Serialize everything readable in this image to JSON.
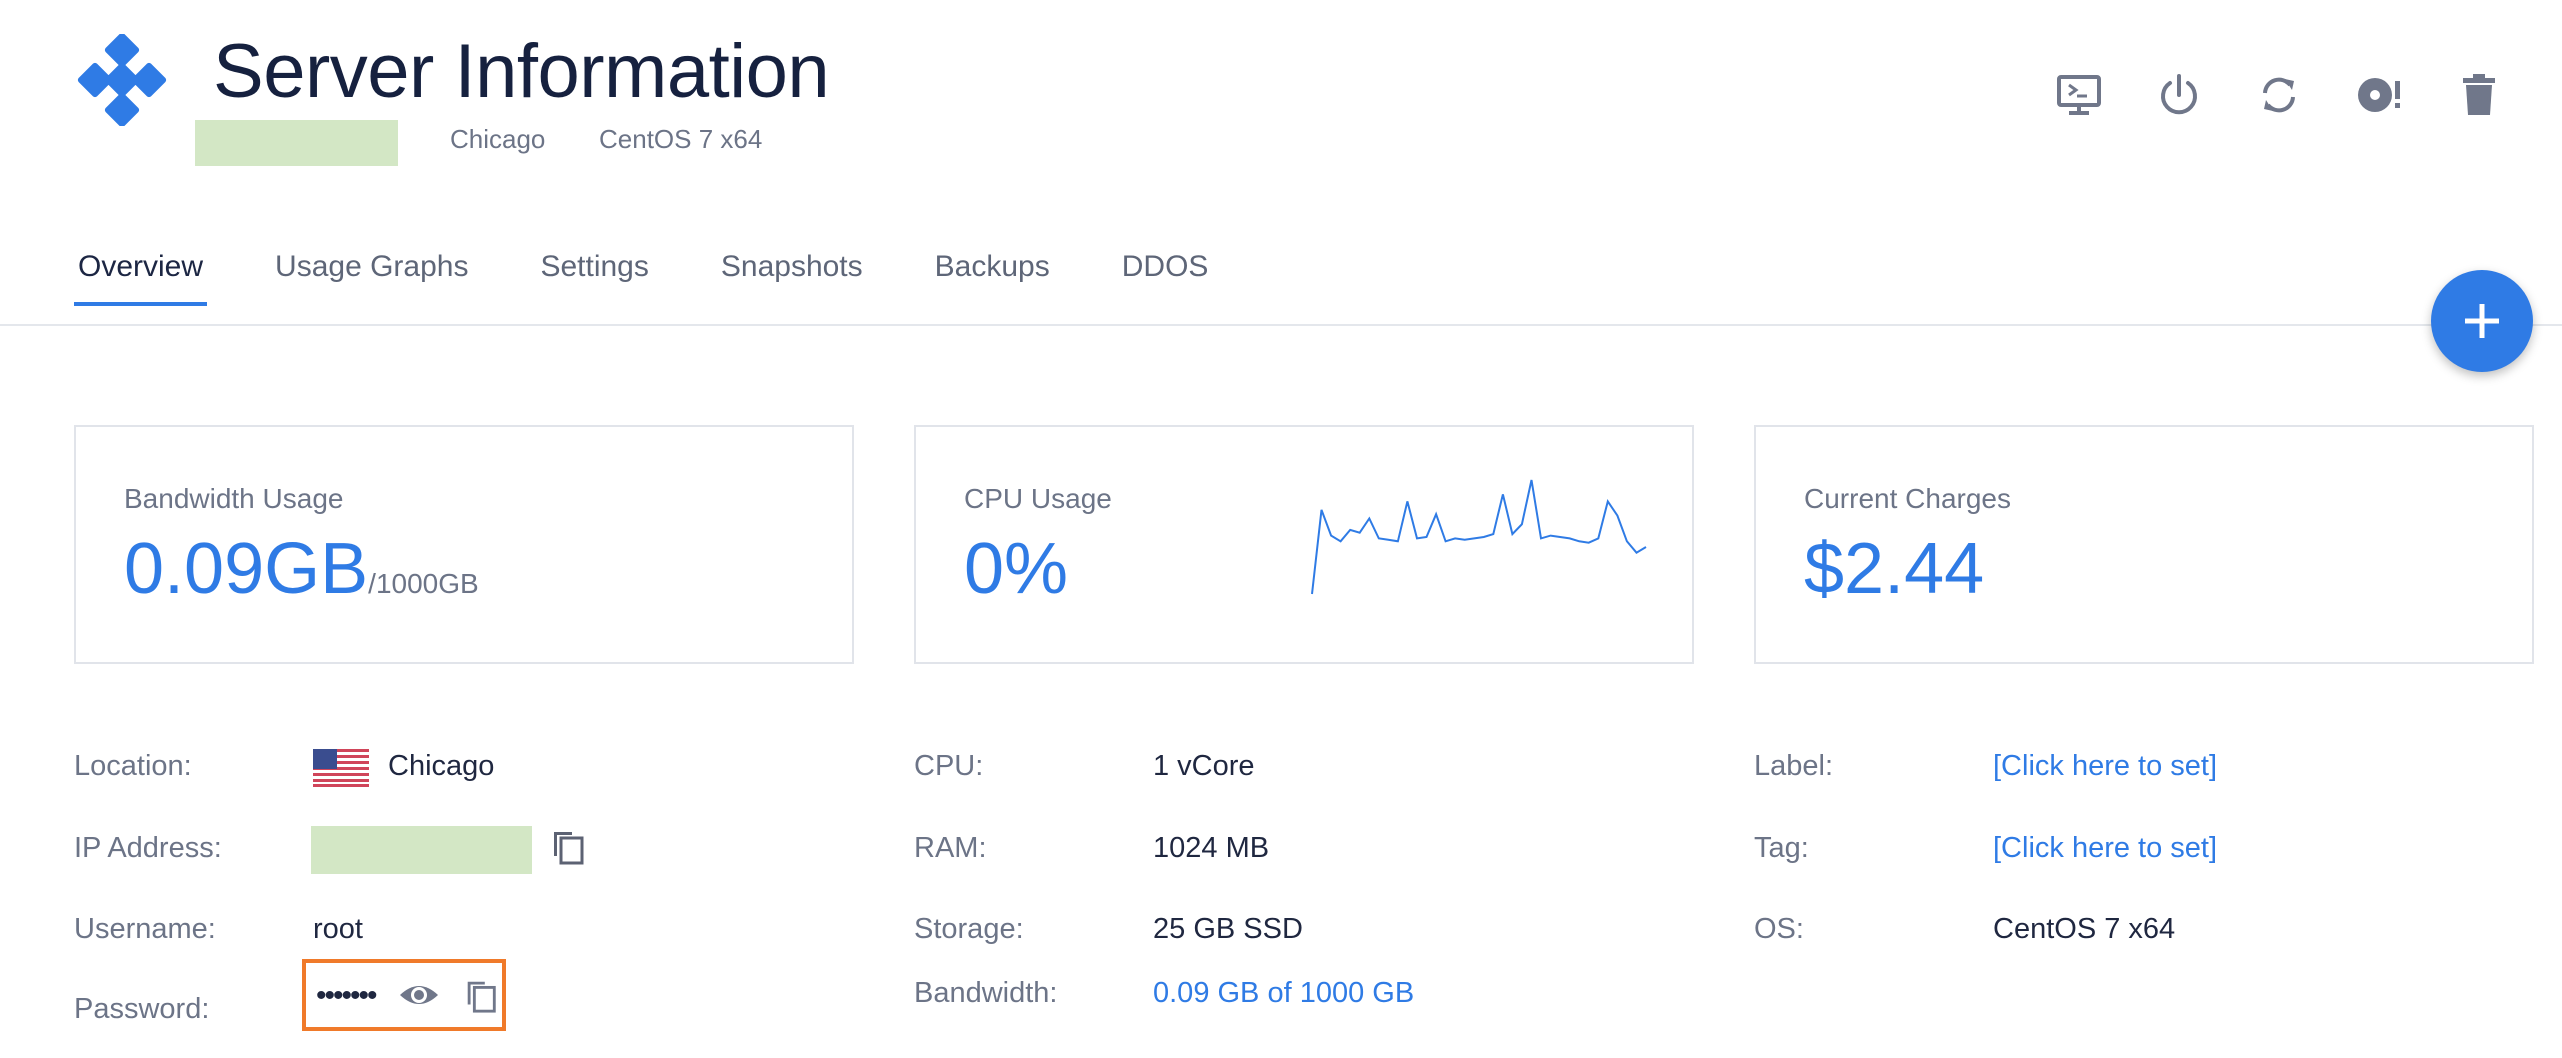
{
  "header": {
    "title": "Server Information",
    "location": "Chicago",
    "os": "CentOS 7 x64"
  },
  "actions": [
    {
      "name": "console-icon"
    },
    {
      "name": "power-icon"
    },
    {
      "name": "restart-icon"
    },
    {
      "name": "reinstall-icon"
    },
    {
      "name": "trash-icon"
    }
  ],
  "tabs": [
    {
      "label": "Overview",
      "active": true
    },
    {
      "label": "Usage Graphs",
      "active": false
    },
    {
      "label": "Settings",
      "active": false
    },
    {
      "label": "Snapshots",
      "active": false
    },
    {
      "label": "Backups",
      "active": false
    },
    {
      "label": "DDOS",
      "active": false
    }
  ],
  "cards": {
    "bandwidth": {
      "label": "Bandwidth Usage",
      "value": "0.09GB",
      "unit": "/1000GB"
    },
    "cpu": {
      "label": "CPU Usage",
      "value": "0%"
    },
    "charges": {
      "label": "Current Charges",
      "value": "$2.44"
    }
  },
  "cpu_sparkline": [
    3,
    62,
    44,
    40,
    48,
    46,
    56,
    42,
    41,
    40,
    68,
    42,
    43,
    59,
    40,
    42,
    41,
    42,
    43,
    45,
    73,
    45,
    52,
    83,
    42,
    44,
    43,
    42,
    40,
    39,
    42,
    68,
    58,
    40,
    32,
    36
  ],
  "details": {
    "location_label": "Location:",
    "location_value": "Chicago",
    "ip_label": "IP Address:",
    "username_label": "Username:",
    "username_value": "root",
    "password_label": "Password:",
    "password_masked": "•••••••",
    "cpu_label": "CPU:",
    "cpu_value": "1 vCore",
    "ram_label": "RAM:",
    "ram_value": "1024 MB",
    "storage_label": "Storage:",
    "storage_value": "25 GB SSD",
    "bandwidth_label": "Bandwidth:",
    "bandwidth_value": "0.09 GB of 1000 GB",
    "label_label": "Label:",
    "label_value": "[Click here to set]",
    "tag_label": "Tag:",
    "tag_value": "[Click here to set]",
    "os_label": "OS:",
    "os_value": "CentOS 7 x64"
  },
  "colors": {
    "accent": "#2f7be5",
    "highlight": "#f07a2a",
    "redacted": "#d3e7c5"
  }
}
